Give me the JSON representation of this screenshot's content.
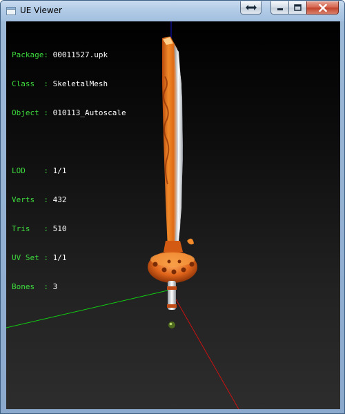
{
  "window": {
    "title": "UE Viewer",
    "controls": {
      "extra_icon": "double-arrow-icon",
      "minimize_icon": "minimize-icon",
      "maximize_icon": "maximize-icon",
      "close_icon": "close-icon"
    }
  },
  "info": {
    "package_label": "Package:",
    "package_value": "00011527.upk",
    "class_label": "Class  :",
    "class_value": "SkeletalMesh",
    "object_label": "Object :",
    "object_value": "010113_Autoscale",
    "lod_label": "LOD    :",
    "lod_value": "1/1",
    "verts_label": "Verts  :",
    "verts_value": "432",
    "tris_label": "Tris   :",
    "tris_value": "510",
    "uvset_label": "UV Set :",
    "uvset_value": "1/1",
    "bones_label": "Bones  :",
    "bones_value": "3"
  },
  "colors": {
    "label": "#3ddc3d",
    "value": "#ffffff",
    "axis_x": "#cc1111",
    "axis_y": "#11cc11",
    "axis_z": "#1111cc",
    "blade_main": "#e8701a"
  }
}
